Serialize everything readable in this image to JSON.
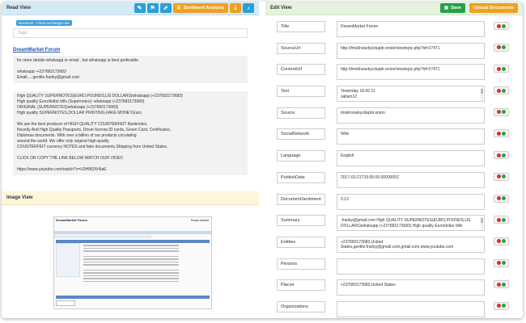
{
  "read_view": {
    "title": "Read View",
    "sentiment_label": "Sentiment Analysis",
    "tag_pill": "Business - Fixed exchange rate",
    "tags_placeholder": "Tags",
    "doc_title": "DreamMarket Forum",
    "block1": "for more details whatsapp or email , but whatsapp is best preferable\n\nwhatsapp:-+237683173683\nEmail.....gentile.franky@gmail.com",
    "block2": "High QUALITY SUPERNOTES(EURO,POUNDS,US DOLLARS)whatsapp (+237683173683)\nHigh quality Euro/dollar bills (Supernotes):-whatsapp (+237683173683)\nORIGINAL (SUPERNOTES)whatsapp (+237683173683)\nHigh quality SUPERNOTES,DOLLAR PRINTING,FAKE MONEY,Euro\n\nWe are the best producer of HIGH QUALITY COUNTERFEIT Banknotes.\nNovelty And High Quality Passports, Driver license,ID cards, Green Card, Certificates,\nDiplomas documents. With over a billion of our products circulating\naround the world. We offer only original high-quality\nCOUNTERFEIT currency NOTES and fake documents.Shipping from United States.\n\nCLICK OR COPY THE LINK BELOW WATCH OUR VIDEO\n\nhttps://www.youtube.com/watch?v=U3HIB3XrNaE"
  },
  "image_view": {
    "title": "Image View",
    "thumb_title": "DreamMarket Forum",
    "thumb_side": "Dream Market"
  },
  "edit_view": {
    "title": "Edit View",
    "save_label": "Save",
    "upload_label": "Upload Documents",
    "fields": [
      {
        "label": "Title",
        "value": "DreamMarket Forum"
      },
      {
        "label": "SourceUrl",
        "value": "http://tmskhzavkycdupbr.onion/viewtopic.php?id=27471"
      },
      {
        "label": "ContentUrl",
        "value": "http://tmskhzavkycdupbr.onion/viewtopic.php?id=27471"
      },
      {
        "label": "Text",
        "value": "Yesterday 16:42:11\nsallam12"
      },
      {
        "label": "Source",
        "value": "tmskhzavkycdupbr.onion"
      },
      {
        "label": "SocialNetwork",
        "value": "Web"
      },
      {
        "label": "Language",
        "value": "English"
      },
      {
        "label": "PublishDate",
        "value": "2017-03-21T16:00:00.0000000Z"
      },
      {
        "label": "DocumentSentiment",
        "value": "0.13"
      },
      {
        "label": "Summary",
        "value": ".franky@gmail.com High QUALITY SUPERNOTES(EURO,POUNDS,US DOLLARS)whatsapp (+237683173683) High quality Euro/dollar bills"
      },
      {
        "label": "Entities",
        "value": "+237683173683,United States,gentile.franky@gmail.com,gmail.com,www.youtube.com"
      },
      {
        "label": "Persons",
        "value": ""
      },
      {
        "label": "Places",
        "value": "+237683173683,United States"
      },
      {
        "label": "Organizations",
        "value": ""
      }
    ]
  }
}
